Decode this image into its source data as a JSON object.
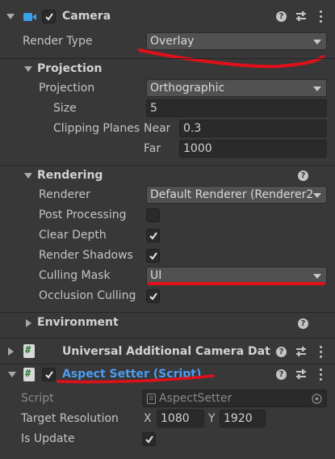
{
  "camera": {
    "title": "Camera",
    "render_type_label": "Render Type",
    "render_type_value": "Overlay"
  },
  "projection": {
    "header": "Projection",
    "projection_label": "Projection",
    "projection_value": "Orthographic",
    "size_label": "Size",
    "size_value": "5",
    "clipping_label": "Clipping Planes",
    "near_label": "Near",
    "near_value": "0.3",
    "far_label": "Far",
    "far_value": "1000"
  },
  "rendering": {
    "header": "Rendering",
    "renderer_label": "Renderer",
    "renderer_value": "Default Renderer (Renderer2",
    "post_processing_label": "Post Processing",
    "clear_depth_label": "Clear Depth",
    "render_shadows_label": "Render Shadows",
    "culling_mask_label": "Culling Mask",
    "culling_mask_value": "UI",
    "occlusion_culling_label": "Occlusion Culling"
  },
  "environment": {
    "header": "Environment"
  },
  "universal_data": {
    "title": "Universal Additional Camera Data ("
  },
  "aspect_setter": {
    "title": "Aspect Setter (Script)",
    "script_label": "Script",
    "script_value": "AspectSetter",
    "target_resolution_label": "Target Resolution",
    "x_label": "X",
    "x_value": "1080",
    "y_label": "Y",
    "y_value": "1920",
    "is_update_label": "Is Update"
  },
  "colors": {
    "background": "#383838",
    "link_blue": "#4c9cf0",
    "annotation_red": "#e0101a"
  },
  "checkboxes": {
    "camera_enabled": true,
    "post_processing": false,
    "clear_depth": true,
    "render_shadows": true,
    "occlusion_culling": true,
    "aspect_setter_enabled": true,
    "is_update": true
  }
}
